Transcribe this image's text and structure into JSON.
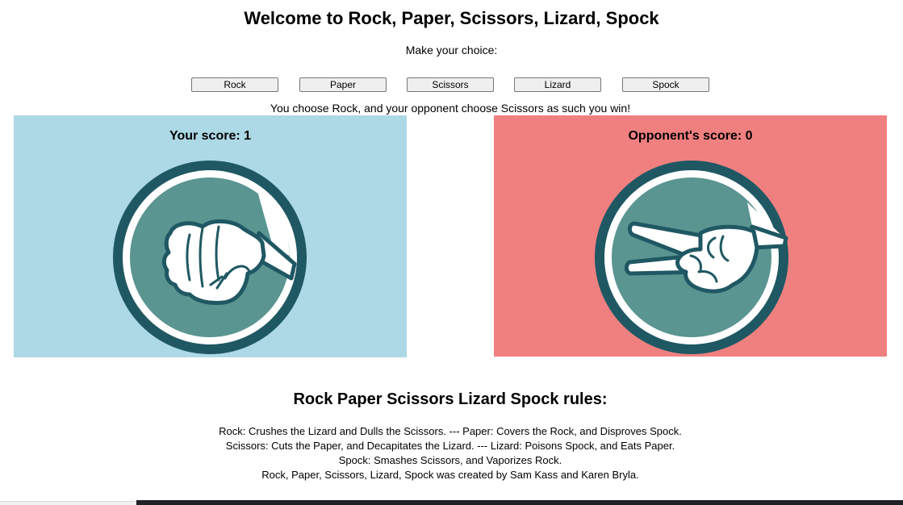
{
  "header": {
    "title": "Welcome to Rock, Paper, Scissors, Lizard, Spock",
    "prompt": "Make your choice:"
  },
  "choices": [
    {
      "label": "Rock"
    },
    {
      "label": "Paper"
    },
    {
      "label": "Scissors"
    },
    {
      "label": "Lizard"
    },
    {
      "label": "Spock"
    }
  ],
  "result": "You choose Rock, and your opponent choose Scissors as such you win!",
  "player": {
    "score_text": "Your score: 1",
    "score": 1,
    "choice_icon": "rock-fist-icon",
    "panel_color": "#add8e6"
  },
  "opponent": {
    "score_text": "Opponent's score: 0",
    "score": 0,
    "choice_icon": "scissors-hand-icon",
    "panel_color": "#f08080"
  },
  "icon_colors": {
    "ring": "#1f5863",
    "fill": "#5a9591",
    "outline": "#ffffff",
    "hand": "#ffffff"
  },
  "rules": {
    "title": "Rock Paper Scissors Lizard Spock rules:",
    "lines": [
      "Rock: Crushes the Lizard and Dulls the Scissors. --- Paper: Covers the Rock, and Disproves Spock.",
      "Scissors: Cuts the Paper, and Decapitates the Lizard. --- Lizard: Poisons Spock, and Eats Paper.",
      "Spock: Smashes Scissors, and Vaporizes Rock.",
      "Rock, Paper, Scissors, Lizard, Spock was created by Sam Kass and Karen Bryla."
    ]
  }
}
